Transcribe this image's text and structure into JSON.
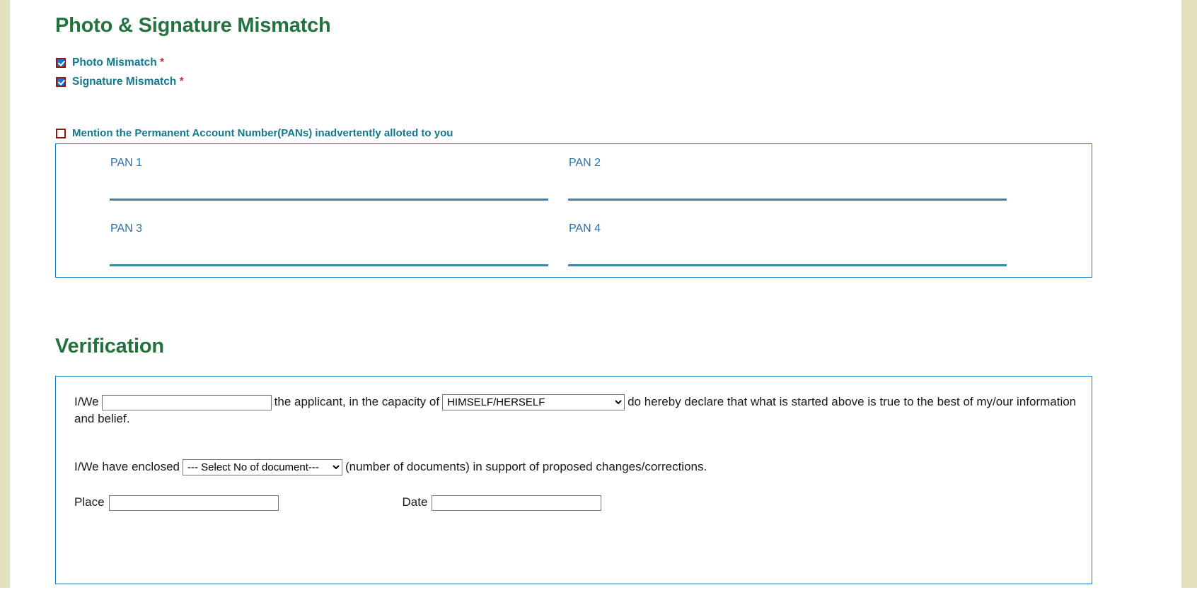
{
  "theme": {
    "heading_color": "#23733f",
    "label_color": "#10788f",
    "panel_border_color": "#1278be",
    "pan_label_color": "#2a6fa8",
    "checkbox_border_color": "#8b1a11",
    "checkbox_fill_color": "#1575e0",
    "required_marker_color": "#c0392b",
    "gutter_color": "#e3e0bd"
  },
  "photo_signature_section": {
    "heading": "Photo & Signature Mismatch",
    "checkboxes": [
      {
        "label": "Photo Mismatch",
        "required_marker": "*",
        "checked": true
      },
      {
        "label": "Signature Mismatch",
        "required_marker": "*",
        "checked": true
      }
    ],
    "mention_checkbox": {
      "label": "Mention the Permanent Account Number(PANs) inadvertently alloted to you",
      "checked": false
    },
    "pan_fields": [
      {
        "label": "PAN 1",
        "value": "",
        "placeholder": ""
      },
      {
        "label": "PAN 2",
        "value": "",
        "placeholder": ""
      },
      {
        "label": "PAN 3",
        "value": "",
        "placeholder": ""
      },
      {
        "label": "PAN 4",
        "value": "",
        "placeholder": ""
      }
    ]
  },
  "verification_section": {
    "heading": "Verification",
    "declaration": {
      "prefix": "I/We",
      "applicant_name": {
        "value": "",
        "placeholder": ""
      },
      "middle_text": "the applicant, in the capacity of",
      "capacity_select": {
        "selected": "HIMSELF/HERSELF",
        "options": [
          "HIMSELF/HERSELF"
        ]
      },
      "suffix": "do hereby declare that what is started above is true to the best of my/our information and belief."
    },
    "enclosure": {
      "prefix": "I/We have enclosed",
      "document_count_select": {
        "selected": "--- Select No of document---",
        "options": [
          "--- Select No of document---"
        ]
      },
      "suffix": "(number of documents) in support of proposed changes/corrections."
    },
    "place": {
      "label": "Place",
      "value": "",
      "placeholder": ""
    },
    "date": {
      "label": "Date",
      "value": "",
      "placeholder": ""
    }
  }
}
